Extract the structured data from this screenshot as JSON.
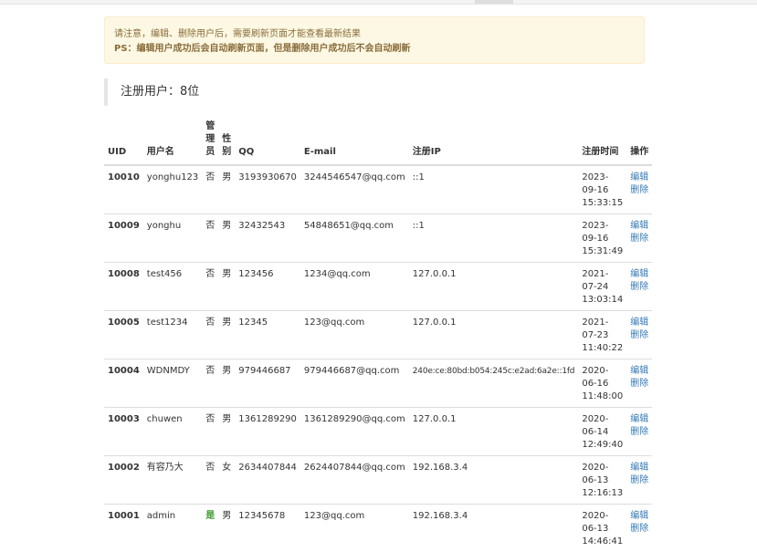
{
  "notice": {
    "line1": "请注意，编辑、删除用户后，需要刷新页面才能查看最新结果",
    "line2": "PS：编辑用户成功后会自动刷新页面，但是删除用户成功后不会自动刷新"
  },
  "user_count": "注册用户：8位",
  "columns": {
    "uid": "UID",
    "username": "用户名",
    "admin": [
      "管",
      "理",
      "员"
    ],
    "gender": [
      "性",
      "别"
    ],
    "qq": "QQ",
    "email": "E-mail",
    "ip": "注册IP",
    "time": "注册时间",
    "ops": "操作"
  },
  "actions": {
    "edit": "编辑",
    "delete": "删除"
  },
  "rows": [
    {
      "uid": "10010",
      "username": "yonghu123",
      "admin": "否",
      "gender": "男",
      "qq": "3193930670",
      "email": "3244546547@qq.com",
      "ip": "::1",
      "date": "2023-09-16",
      "time": "15:33:15"
    },
    {
      "uid": "10009",
      "username": "yonghu",
      "admin": "否",
      "gender": "男",
      "qq": "32432543",
      "email": "54848651@qq.com",
      "ip": "::1",
      "date": "2023-09-16",
      "time": "15:31:49"
    },
    {
      "uid": "10008",
      "username": "test456",
      "admin": "否",
      "gender": "男",
      "qq": "123456",
      "email": "1234@qq.com",
      "ip": "127.0.0.1",
      "date": "2021-07-24",
      "time": "13:03:14"
    },
    {
      "uid": "10005",
      "username": "test1234",
      "admin": "否",
      "gender": "男",
      "qq": "12345",
      "email": "123@qq.com",
      "ip": "127.0.0.1",
      "date": "2021-07-23",
      "time": "11:40:22"
    },
    {
      "uid": "10004",
      "username": "WDNMDY",
      "admin": "否",
      "gender": "男",
      "qq": "979446687",
      "email": "979446687@qq.com",
      "ip": "240e:ce:80bd:b054:245c:e2ad:6a2e::1fd",
      "date": "2020-06-16",
      "time": "11:48:00"
    },
    {
      "uid": "10003",
      "username": "chuwen",
      "admin": "否",
      "gender": "男",
      "qq": "1361289290",
      "email": "1361289290@qq.com",
      "ip": "127.0.0.1",
      "date": "2020-06-14",
      "time": "12:49:40"
    },
    {
      "uid": "10002",
      "username": "有容乃大",
      "admin": "否",
      "gender": "女",
      "qq": "2634407844",
      "email": "2624407844@qq.com",
      "ip": "192.168.3.4",
      "date": "2020-06-13",
      "time": "12:16:13"
    },
    {
      "uid": "10001",
      "username": "admin",
      "admin": "是",
      "gender": "男",
      "qq": "12345678",
      "email": "123@qq.com",
      "ip": "192.168.3.4",
      "date": "2020-06-13",
      "time": "14:46:41"
    }
  ]
}
